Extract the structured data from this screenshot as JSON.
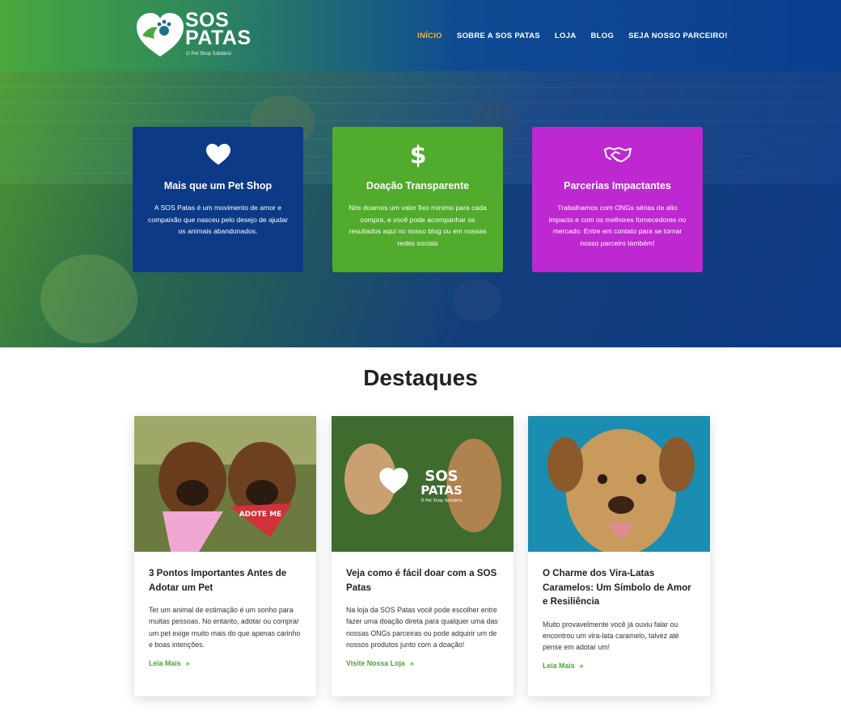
{
  "brand": {
    "name_line1": "SOS",
    "name_line2": "PATAS",
    "tagline": "O Pet Shop Solidário",
    "colors": {
      "blue": "#0c3a86",
      "green": "#51ab2c",
      "purple": "#be28d0",
      "active_nav": "#f3b72a"
    }
  },
  "nav": {
    "items": [
      {
        "label": "INÍCIO",
        "active": true
      },
      {
        "label": "SOBRE A SOS PATAS"
      },
      {
        "label": "LOJA"
      },
      {
        "label": "BLOG"
      },
      {
        "label": "SEJA NOSSO PARCEIRO!"
      }
    ]
  },
  "features": [
    {
      "icon": "heart-icon",
      "title": "Mais que um Pet Shop",
      "text": "A SOS Patas é um movimento de amor e compaixão que nasceu pelo desejo de ajudar os animais abandonados."
    },
    {
      "icon": "dollar-icon",
      "title": "Doação Transparente",
      "text": "Nós doamos um valor fixo mínimo para cada compra, e você pode acompanhar os resultados aqui no nosso blog ou em nossas redes sociais"
    },
    {
      "icon": "handshake-icon",
      "title": "Parcerias Impactantes",
      "text": "Trabalhamos com ONGs sérias de alto impacto e com os melhores fornecedores no mercado. Entre em contato para se tornar nosso parceiro também!"
    }
  ],
  "highlights": {
    "title": "Destaques",
    "cards": [
      {
        "title": "3 Pontos Importantes Antes de Adotar um Pet",
        "excerpt": "Ter um animal de estimação é um sonho para muitas pessoas. No entanto, adotar ou comprar um pet exige muito mais do que apenas carinho e boas intenções.",
        "link": "Leia Mais",
        "badge_text": "ADOTE ME"
      },
      {
        "title": "Veja como é fácil doar com a SOS Patas",
        "excerpt": "Na loja da SOS Patas você pode escolher entre fazer uma doação direta para qualquer uma das nossas ONGs parceiras ou pode adquirir um de nossos produtos junto com a doação!",
        "link": "Visite Nossa Loja",
        "overlay_line1": "SOS",
        "overlay_line2": "PATAS",
        "overlay_tag": "O Pet Shop Solidário"
      },
      {
        "title": "O Charme dos Vira-Latas Caramelos: Um Símbolo de Amor e Resiliência",
        "excerpt": "Muito provavelmente você já ouviu falar ou encontrou um vira-lata caramelo, talvez até pense em adotar um!",
        "link": "Leia Mais"
      }
    ]
  }
}
